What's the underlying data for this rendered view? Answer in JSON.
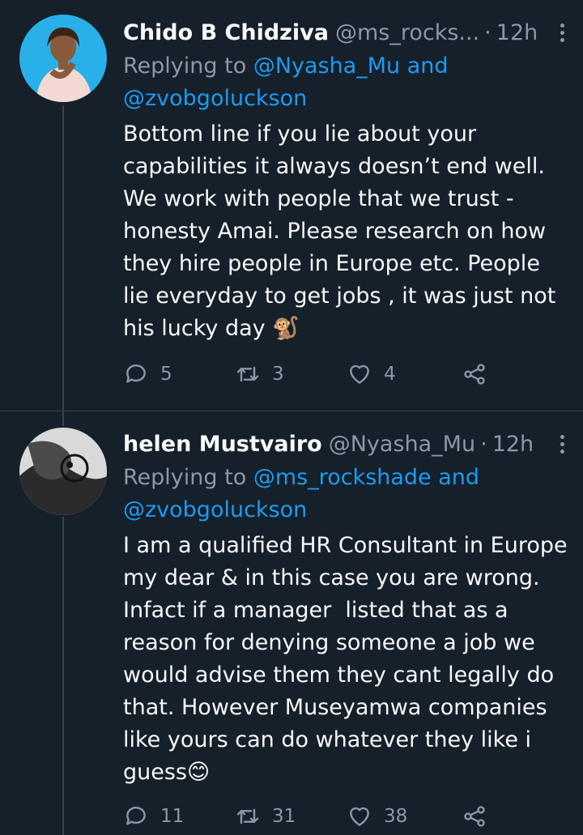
{
  "tweets": [
    {
      "name": "Chido B Chidziva",
      "handle": "@ms_rocks...",
      "dot": "·",
      "time": "12h",
      "replying_prefix": "Replying to ",
      "replying_line1": "@Nyasha_Mu and",
      "replying_line2": "@zvobgoluckson",
      "body": "Bottom line if you lie about your\ncapabilities it always doesn’t end well.\nWe work with people that we trust -\nhonesty Amai. Please research on how\nthey hire people in Europe etc. People\nlie everyday to get jobs , it was just not\nhis lucky day 🐒",
      "replies": "5",
      "retweets": "3",
      "likes": "4"
    },
    {
      "name": "helen Mustvairo",
      "handle": "@Nyasha_Mu",
      "dot": "·",
      "time": "12h",
      "replying_prefix": "Replying to ",
      "replying_line1": "@ms_rockshade and",
      "replying_line2": "@zvobgoluckson",
      "body": "I am a qualified HR Consultant in Europe\nmy dear & in this case you are wrong.\nInfact if a manager  listed that as a\nreason for denying someone a job we\nwould advise them they cant legally do\nthat. However Museyamwa companies\nlike yours can do whatever they like i\nguess😊",
      "replies": "11",
      "retweets": "31",
      "likes": "38"
    }
  ],
  "colors": {
    "background": "#15202b",
    "text": "#f7f9f9",
    "secondary": "#8b98a5",
    "accent": "#1d9bf0",
    "divider": "#38444d"
  },
  "icons": [
    "reply-icon",
    "retweet-icon",
    "like-icon",
    "share-icon",
    "more-icon"
  ]
}
